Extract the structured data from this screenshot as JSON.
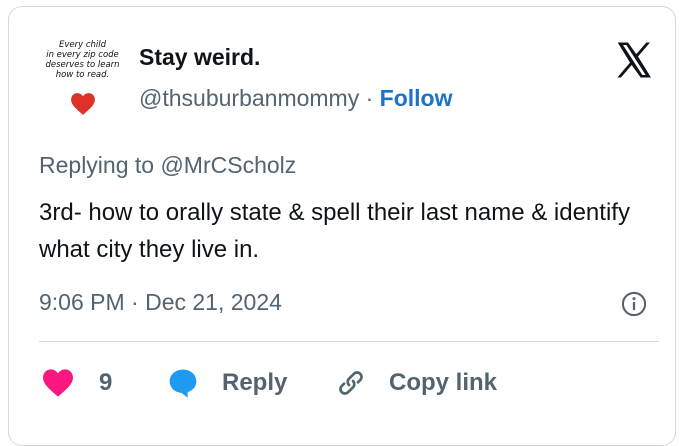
{
  "tweet": {
    "avatar": {
      "text": "Every child\nin every zip code\ndeserves to learn\nhow to read.",
      "heart_color": "#e0302a"
    },
    "display_name": "Stay weird.",
    "handle": "@thsuburbanmommy",
    "separator": "·",
    "follow_label": "Follow",
    "replying_to": "Replying to @MrCScholz",
    "text": "3rd- how to orally state & spell their last name & identify what city they live in.",
    "timestamp": "9:06 PM · Dec 21, 2024",
    "actions": {
      "like_count": "9",
      "reply_label": "Reply",
      "copy_label": "Copy link"
    },
    "icons": {
      "platform_logo": "x-logo-icon",
      "info": "info-icon",
      "like": "heart-icon",
      "reply": "reply-bubble-icon",
      "copy": "link-icon"
    },
    "colors": {
      "follow": "#1d73c8",
      "like": "#f91880",
      "reply": "#1d9bf0",
      "muted": "#536471",
      "text": "#0f1419",
      "border": "#cfd9de"
    }
  }
}
